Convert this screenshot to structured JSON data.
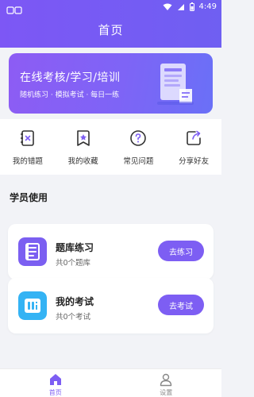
{
  "status": {
    "time": "4:49"
  },
  "header": {
    "title": "首页"
  },
  "banner": {
    "title": "在线考核/学习/培训",
    "subtitle": "随机练习 · 模拟考试 · 每日一练"
  },
  "quick_nav": [
    {
      "label": "我的错题",
      "icon": "wrong-questions-icon"
    },
    {
      "label": "我的收藏",
      "icon": "favorites-icon"
    },
    {
      "label": "常见问题",
      "icon": "faq-icon"
    },
    {
      "label": "分享好友",
      "icon": "share-icon"
    }
  ],
  "section": {
    "title": "学员使用"
  },
  "cards": [
    {
      "name": "题库练习",
      "count": "共0个题库",
      "button": "去练习",
      "icon": "question-bank-icon",
      "color": "#7b5ff1"
    },
    {
      "name": "我的考试",
      "count": "共0个考试",
      "button": "去考试",
      "icon": "exam-icon",
      "color": "#34b3f4"
    }
  ],
  "tabbar": [
    {
      "label": "首页",
      "icon": "home-icon",
      "active": true
    },
    {
      "label": "设置",
      "icon": "user-settings-icon",
      "active": false
    }
  ],
  "colors": {
    "primary": "#7d5ef3",
    "accent_blue": "#34b3f4",
    "background": "#f2f3f7"
  }
}
